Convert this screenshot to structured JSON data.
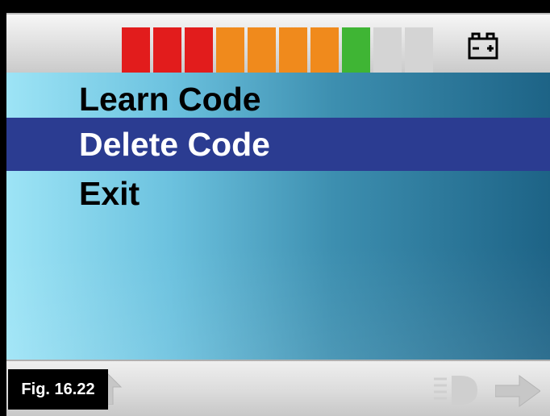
{
  "battery": {
    "segments": [
      {
        "color": "#e21c1c"
      },
      {
        "color": "#e21c1c"
      },
      {
        "color": "#e21c1c"
      },
      {
        "color": "#f08a1c"
      },
      {
        "color": "#f08a1c"
      },
      {
        "color": "#f08a1c"
      },
      {
        "color": "#f08a1c"
      },
      {
        "color": "#3fb534"
      },
      {
        "color": "#d4d4d4"
      },
      {
        "color": "#d4d4d4"
      }
    ],
    "level": 0.8,
    "icon": "battery-icon"
  },
  "menu": {
    "items": [
      {
        "label": "Learn Code",
        "selected": false
      },
      {
        "label": "Delete Code",
        "selected": true
      },
      {
        "label": "Exit",
        "selected": false
      }
    ]
  },
  "nav": {
    "icons": [
      "arrow-left-icon",
      "arrow-up-icon",
      "headlight-icon",
      "arrow-right-icon"
    ]
  },
  "figure": {
    "label": "Fig. 16.22"
  },
  "colors": {
    "selection": "#2b3c91"
  }
}
